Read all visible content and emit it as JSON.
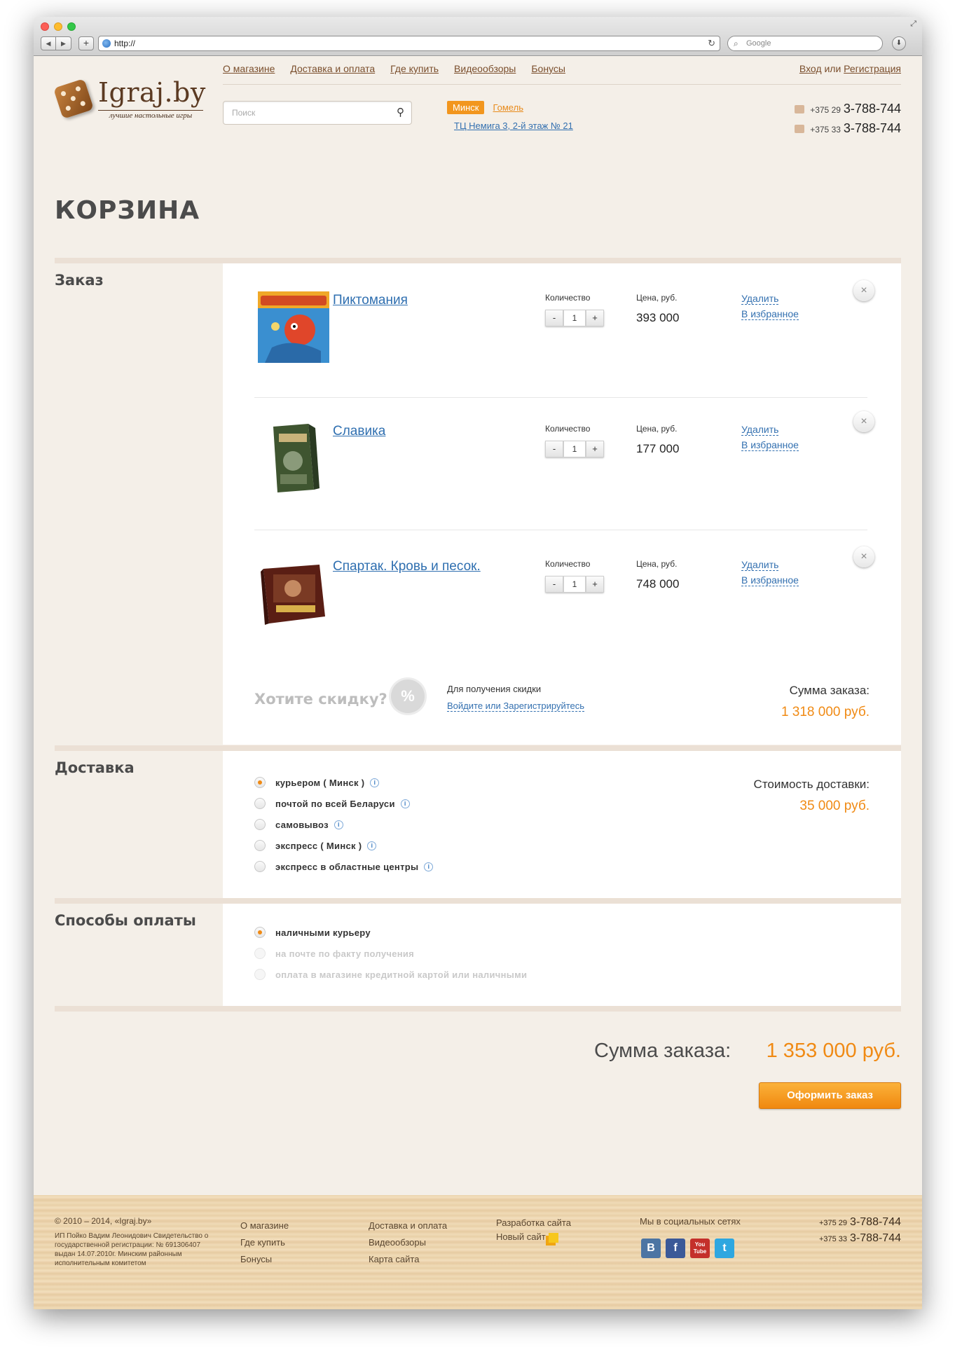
{
  "browser": {
    "url": "http://",
    "search_placeholder": "Google"
  },
  "header": {
    "nav": [
      "О магазине",
      "Доставка и оплата",
      "Где купить",
      "Видеообзоры",
      "Бонусы"
    ],
    "login": "Вход",
    "login_sep": "или",
    "register": "Регистрация",
    "logo_text": "Igraj.by",
    "logo_subtitle": "лучшие настольные игры",
    "search_placeholder": "Поиск",
    "city_active": "Минск",
    "city_other": "Гомель",
    "address": "ТЦ Немига 3, 2-й этаж № 21",
    "phones": [
      {
        "code": "+375 29",
        "number": "3-788-744"
      },
      {
        "code": "+375 33",
        "number": "3-788-744"
      }
    ]
  },
  "page_title": "КОРЗИНА",
  "order": {
    "section_title": "Заказ",
    "qty_label": "Количество",
    "price_label": "Цена, руб.",
    "delete_label": "Удалить",
    "fav_label": "В избранное",
    "items": [
      {
        "name": "Пиктомания",
        "qty": "1",
        "price": "393 000"
      },
      {
        "name": "Славика",
        "qty": "1",
        "price": "177 000"
      },
      {
        "name": "Спартак. Кровь и песок.",
        "qty": "1",
        "price": "748 000"
      }
    ],
    "discount_title": "Хотите скидку?",
    "discount_badge": "%",
    "discount_note": "Для получения скидки",
    "discount_link": "Войдите или Зарегистрируйтесь",
    "sum_label": "Сумма заказа:",
    "sum_value": "1 318 000 руб."
  },
  "delivery": {
    "section_title": "Доставка",
    "options": [
      "курьером ( Минск )",
      "почтой по всей Беларуси",
      "самовывоз",
      "экспресс ( Минск )",
      "экспресс в областные центры"
    ],
    "selected_index": 0,
    "cost_label": "Стоимость доставки:",
    "cost_value": "35 000 руб."
  },
  "payment": {
    "section_title": "Способы оплаты",
    "options": [
      "наличными курьеру",
      "на почте по факту получения",
      "оплата в магазине кредитной картой или наличными"
    ],
    "selected_index": 0
  },
  "total": {
    "label": "Сумма заказа:",
    "value": "1 353 000 руб.",
    "checkout_button": "Оформить заказ"
  },
  "footer": {
    "copyright": "© 2010 – 2014, «Igraj.by»",
    "legal": "ИП Пойко Вадим Леонидович Свидетельство о государственной регистрации: № 691306407 выдан 14.07.2010г. Минским районным исполнительным комитетом",
    "col1": [
      "О магазине",
      "Где купить",
      "Бонусы"
    ],
    "col2": [
      "Доставка и оплата",
      "Видеообзоры",
      "Карта сайта"
    ],
    "dev_label": "Разработка сайта",
    "dev_name": "Новый сайт",
    "social_label": "Мы в социальных сетях",
    "social": {
      "vk": "В",
      "fb": "f",
      "yt": "You Tube",
      "tw": "t"
    },
    "phones": [
      {
        "code": "+375 29",
        "number": "3-788-744"
      },
      {
        "code": "+375 33",
        "number": "3-788-744"
      }
    ]
  }
}
